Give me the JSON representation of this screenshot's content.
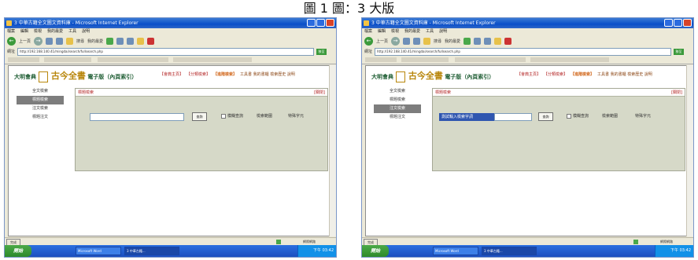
{
  "caption": "圖 1 圖：3 大版",
  "browser": {
    "title": "3 中華古籍全文圖文資料庫 - Microsoft Internet Explorer",
    "menu": [
      "檔案",
      "編輯",
      "檢視",
      "我的最愛",
      "工具",
      "說明"
    ],
    "back_label": "上一頁",
    "search_label": "搜尋",
    "favorites_label": "我的最愛",
    "address_label": "網址",
    "address_value": "http://192.168.140.41/mingdai/search/fullsearch.php",
    "go_label": "移至",
    "status_text": "完成",
    "zone_text": "網際網路",
    "start_label": "開始",
    "clock": "下午 03:42",
    "tasks": [
      "Microsoft Word",
      "3 中華古籍..."
    ]
  },
  "site": {
    "logo_prefix": "大明會典",
    "logo_big": "古今全書",
    "logo_suffix": "電子版（內頁索引）",
    "nav": [
      "【會典主頁】",
      "【分類檢索】",
      "【進階檢索】",
      "工具書  我的書櫃  檢索歷史  說明"
    ],
    "sidebar": [
      "全文檢索",
      "標題檢索",
      "注文檢索",
      "標題注文"
    ],
    "panel_title": "標題檢索",
    "close_label": "[關閉]",
    "search_button": "查詢",
    "opt_checkbox": "模糊查詢",
    "opt_link1": "檢索範圍",
    "opt_link2": "特殊字元"
  },
  "left_shot": {
    "active_item": "標題檢索",
    "search_value": ""
  },
  "right_shot": {
    "active_item": "注文檢索",
    "search_value": "測試輸入檢索字詞"
  }
}
